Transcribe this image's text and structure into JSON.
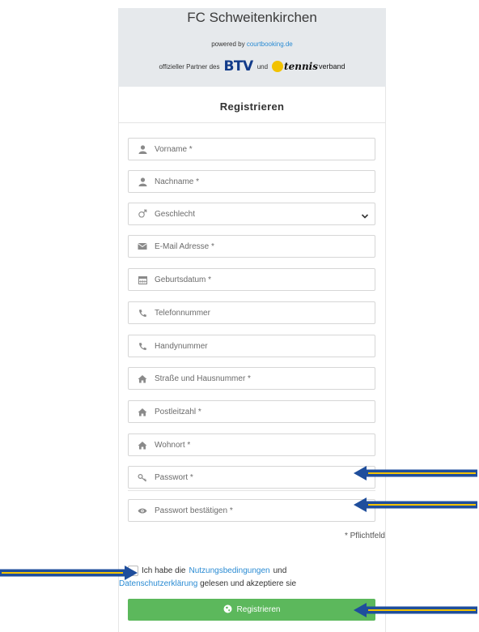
{
  "header": {
    "club_name": "FC Schweitenkirchen",
    "powered_prefix": "powered by",
    "powered_link": "courtbooking.de",
    "partner_prefix": "offizieller Partner des",
    "partner_and": "und",
    "btv_logo": "BTV",
    "tennis_logo_bold": "tennis",
    "tennis_logo_rest": "verband"
  },
  "form": {
    "title": "Registrieren",
    "fields": [
      {
        "icon": "user-icon",
        "placeholder": "Vorname *"
      },
      {
        "icon": "user-icon",
        "placeholder": "Nachname *"
      },
      {
        "icon": "gender-icon",
        "placeholder": "Geschlecht"
      },
      {
        "icon": "envelope-icon",
        "placeholder": "E-Mail Adresse *"
      },
      {
        "icon": "calendar-icon",
        "placeholder": "Geburtsdatum *"
      },
      {
        "icon": "phone-icon",
        "placeholder": "Telefonnummer"
      },
      {
        "icon": "phone-icon",
        "placeholder": "Handynummer"
      },
      {
        "icon": "home-icon",
        "placeholder": "Straße und Hausnummer *"
      },
      {
        "icon": "home-icon",
        "placeholder": "Postleitzahl *"
      },
      {
        "icon": "home-icon",
        "placeholder": "Wohnort *"
      },
      {
        "icon": "key-icon",
        "placeholder": "Passwort *"
      },
      {
        "icon": "eye-icon",
        "placeholder": "Passwort bestätigen *"
      }
    ],
    "required_note": "* Pflichtfeld",
    "consent": {
      "text_1": "Ich habe die",
      "link_1": "Nutzungsbedingungen",
      "text_2": "und",
      "link_2": "Datenschutzerklärung",
      "text_3": "gelesen und akzeptiere sie"
    },
    "submit_label": "Registrieren"
  },
  "colors": {
    "accent_green": "#5cb85c",
    "link_blue": "#2a8bd3",
    "arrow_blue": "#1f4e9c",
    "arrow_yellow": "#f2c200"
  }
}
